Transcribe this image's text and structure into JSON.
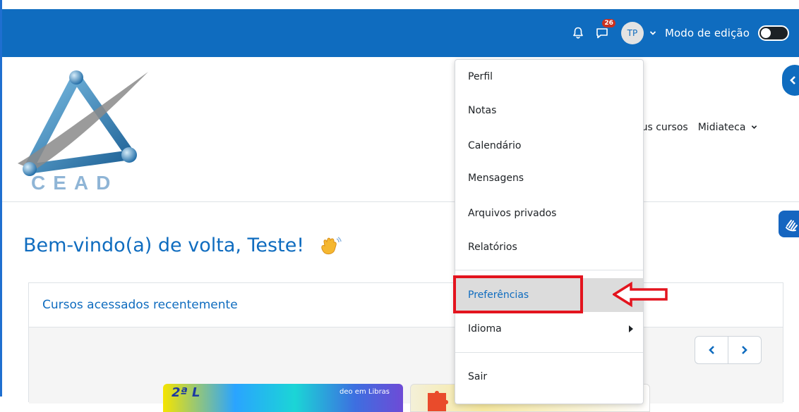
{
  "topbar": {
    "notification_badge": "26",
    "avatar_initials": "TP",
    "edit_mode_label": "Modo de edição",
    "edit_mode_on": false
  },
  "logo": {
    "text": "CEAD"
  },
  "header_nav": {
    "my_courses": "eus cursos",
    "media_library": "Midiateca"
  },
  "welcome": {
    "text": "Bem-vindo(a) de volta, Teste!"
  },
  "recent_courses": {
    "title": "Cursos acessados recentemente",
    "thumb1_text": "2ª L",
    "thumb1_sub": "deo em Libras"
  },
  "user_menu": {
    "items": [
      {
        "label": "Perfil"
      },
      {
        "label": "Notas"
      },
      {
        "label": "Calendário"
      },
      {
        "label": "Mensagens"
      },
      {
        "label": "Arquivos privados"
      },
      {
        "label": "Relatórios"
      },
      {
        "label": "Preferências"
      },
      {
        "label": "Idioma"
      },
      {
        "label": "Sair"
      }
    ]
  },
  "colors": {
    "primary": "#0f6cbf",
    "highlight": "#e3141e",
    "badge": "#ca3120"
  }
}
